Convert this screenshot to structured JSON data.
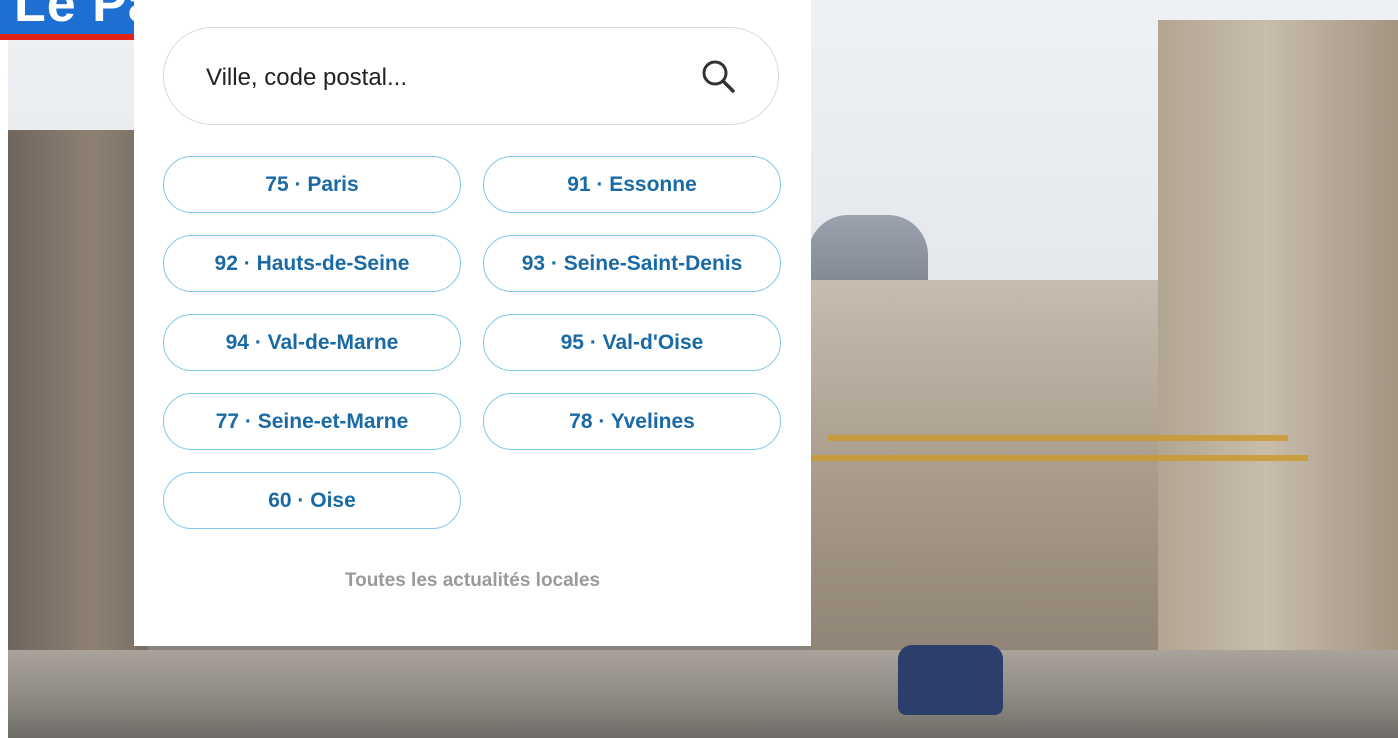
{
  "brand": {
    "logo_text": "Le Parisien"
  },
  "search": {
    "placeholder": "Ville, code postal..."
  },
  "departments": [
    {
      "label": "75 · Paris"
    },
    {
      "label": "91 · Essonne"
    },
    {
      "label": "92 · Hauts-de-Seine"
    },
    {
      "label": "93 · Seine-Saint-Denis"
    },
    {
      "label": "94 · Val-de-Marne"
    },
    {
      "label": "95 · Val-d'Oise"
    },
    {
      "label": "77 · Seine-et-Marne"
    },
    {
      "label": "78 · Yvelines"
    },
    {
      "label": "60 · Oise"
    }
  ],
  "footer_link": {
    "label": "Toutes les actualités locales"
  },
  "colors": {
    "pill_border": "#7ec7ee",
    "pill_text": "#1a6aa6",
    "logo_blue": "#1d6fd1",
    "logo_red": "#e2231a"
  },
  "icons": {
    "search": "search-icon"
  }
}
